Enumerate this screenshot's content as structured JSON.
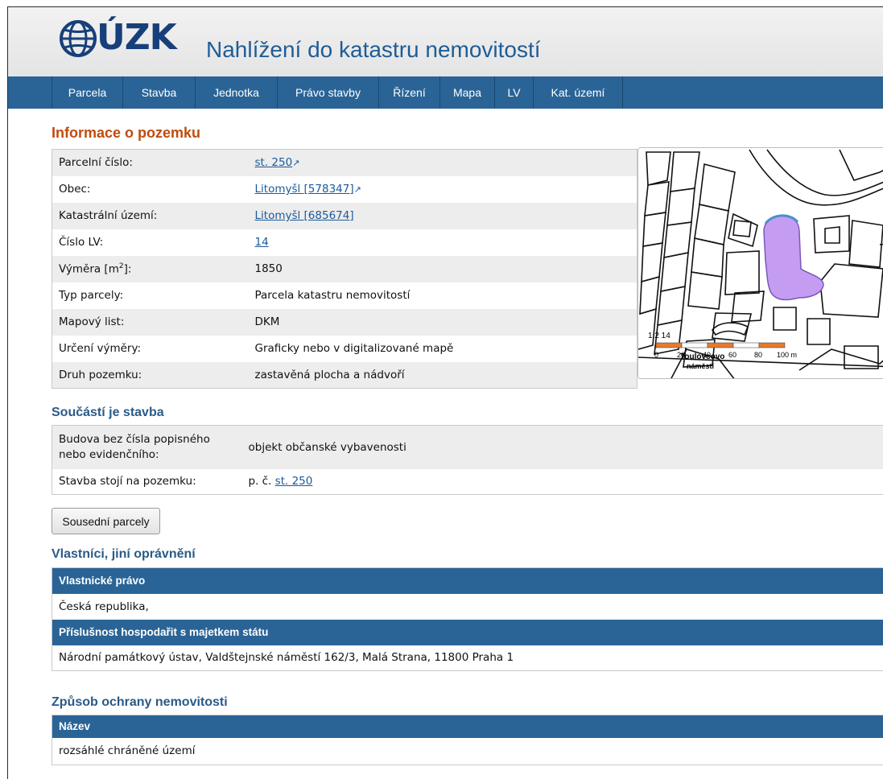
{
  "header": {
    "logo_text": "ÚZK",
    "app_title": "Nahlížení do katastru nemovitostí"
  },
  "nav": [
    "Parcela",
    "Stavba",
    "Jednotka",
    "Právo stavby",
    "Řízení",
    "Mapa",
    "LV",
    "Kat. území"
  ],
  "parcel_info": {
    "heading": "Informace o pozemku",
    "rows": [
      {
        "label": "Parcelní číslo:",
        "value": "st. 250",
        "ext_icon": "↗"
      },
      {
        "label": "Obec:",
        "value": "Litomyšl [578347]",
        "ext_icon": "↗"
      },
      {
        "label": "Katastrální území:",
        "value": "Litomyšl [685674]"
      },
      {
        "label": "Číslo LV:",
        "value": "14"
      },
      {
        "label_pre": "Výměra [m",
        "label_sup": "2",
        "label_post": "]:",
        "value": "1850"
      },
      {
        "label": "Typ parcely:",
        "value": "Parcela katastru nemovitostí"
      },
      {
        "label": "Mapový list:",
        "value": "DKM"
      },
      {
        "label": "Určení výměry:",
        "value": "Graficky nebo v digitalizované mapě"
      },
      {
        "label": "Druh pozemku:",
        "value": "zastavěná plocha a nádvoří"
      }
    ]
  },
  "map": {
    "plot_color": "#c49df2",
    "parcel_label": "1:2 14",
    "square_label_1": "Toulovcovo",
    "square_label_2": "náměstí",
    "scale_labels": [
      "0",
      "20",
      "40",
      "60",
      "80",
      "100 m"
    ]
  },
  "building": {
    "heading": "Součástí je stavba",
    "rows": [
      {
        "label": "Budova bez čísla popisného nebo evidenčního:",
        "value": "objekt občanské vybavenosti"
      },
      {
        "label": "Stavba stojí na pozemku:",
        "value_prefix": "p. č.",
        "value_link": "st. 250"
      }
    ]
  },
  "neighbors_button": "Sousední parcely",
  "owners": {
    "heading": "Vlastníci, jiní oprávnění",
    "sections": [
      {
        "header": "Vlastnické právo",
        "value": "Česká republika,"
      },
      {
        "header": "Příslušnost hospodařit s majetkem státu",
        "value": "Národní památkový ústav, Valdštejnské náměstí 162/3, Malá Strana, 11800 Praha 1"
      }
    ]
  },
  "protection": {
    "heading": "Způsob ochrany nemovitosti",
    "header": "Název",
    "value": "rozsáhlé chráněné území"
  }
}
